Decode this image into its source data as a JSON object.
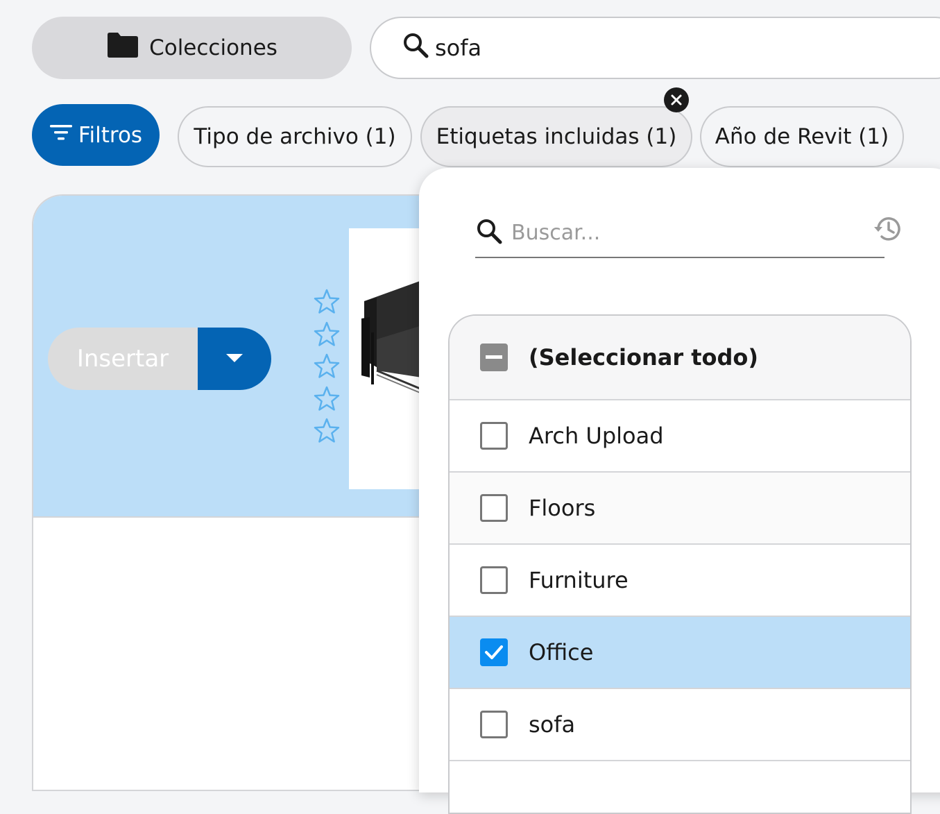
{
  "topbar": {
    "collections_label": "Colecciones",
    "search_value": "sofa"
  },
  "filters": {
    "filters_label": "Filtros",
    "chips": [
      {
        "label": "Tipo de archivo (1)"
      },
      {
        "label": "Etiquetas incluidas (1)"
      },
      {
        "label": "Año de Revit (1)"
      }
    ]
  },
  "card": {
    "insert_label": "Insertar",
    "rating_stars": 5,
    "rating_value": 0
  },
  "tag_panel": {
    "search_placeholder": "Buscar...",
    "select_all_label": "(Seleccionar todo)",
    "select_all_state": "indeterminate",
    "items": [
      {
        "label": "Arch Upload",
        "checked": false
      },
      {
        "label": "Floors",
        "checked": false
      },
      {
        "label": "Furniture",
        "checked": false
      },
      {
        "label": "Office",
        "checked": true
      },
      {
        "label": "sofa",
        "checked": false
      }
    ]
  },
  "colors": {
    "primary": "#0464b4",
    "selection": "#bcdef8",
    "checkbox_checked": "#0a8cf0"
  }
}
